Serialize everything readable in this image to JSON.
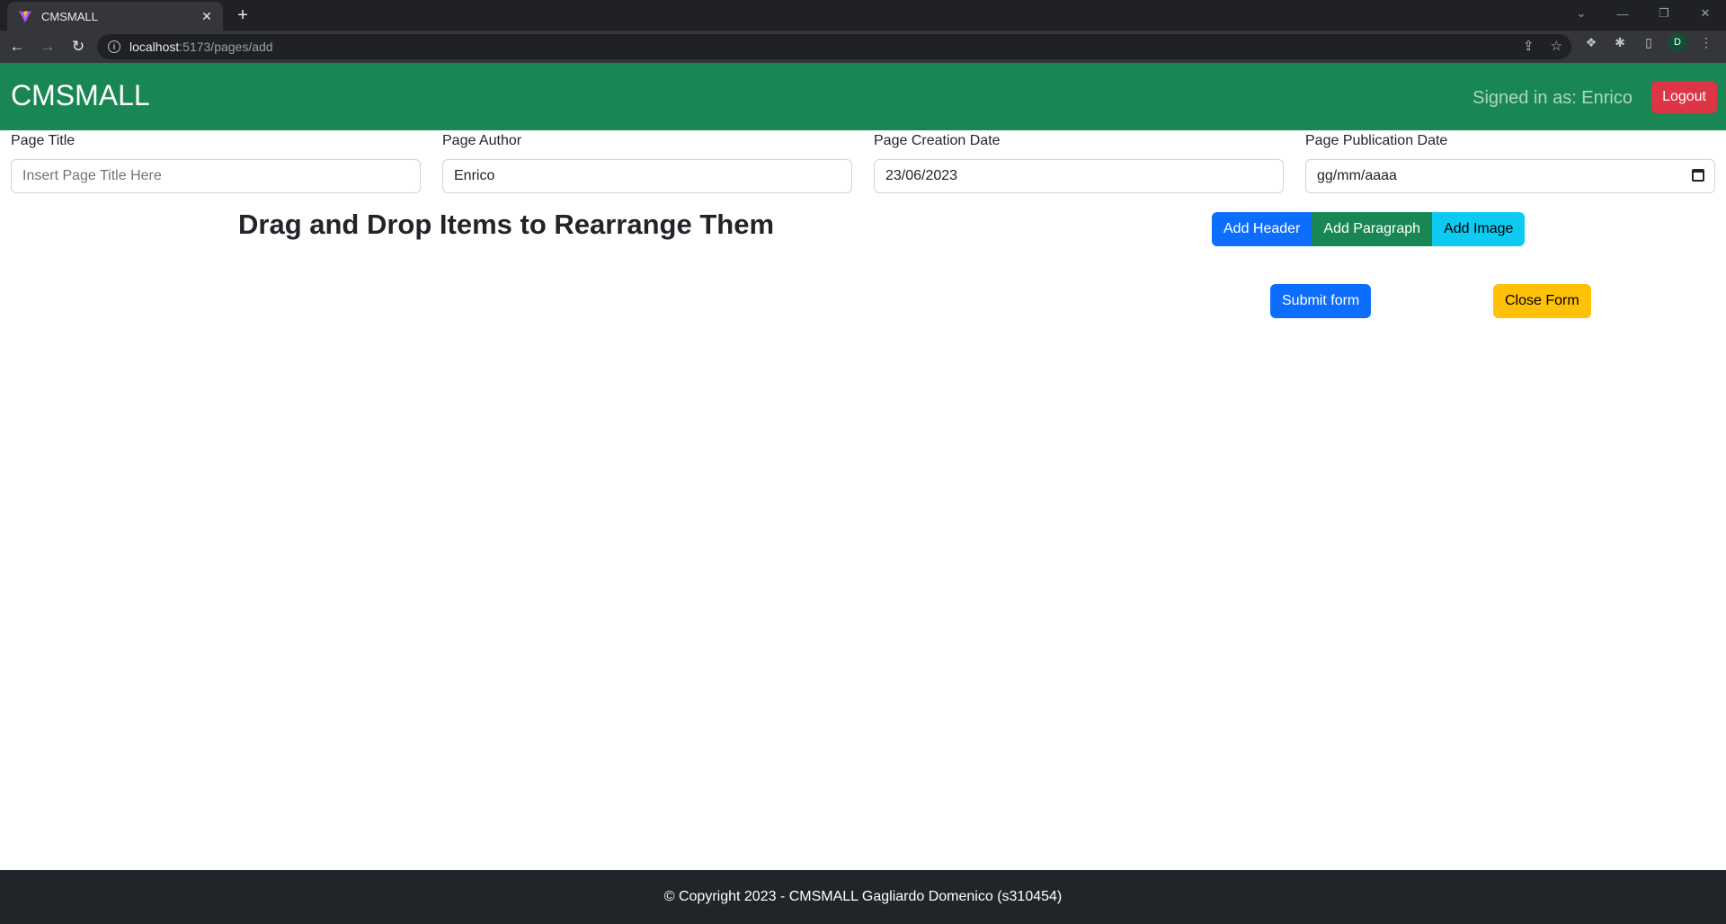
{
  "browser": {
    "tab_title": "CMSMALL",
    "url_host": "localhost",
    "url_path": ":5173/pages/add",
    "profile_initial": "D"
  },
  "navbar": {
    "brand": "CMSMALL",
    "signed_in_text": "Signed in as: Enrico",
    "logout_label": "Logout"
  },
  "form": {
    "title": {
      "label": "Page Title",
      "placeholder": "Insert Page Title Here",
      "value": ""
    },
    "author": {
      "label": "Page Author",
      "value": "Enrico"
    },
    "creation_date": {
      "label": "Page Creation Date",
      "value": "23/06/2023"
    },
    "publication_date": {
      "label": "Page Publication Date",
      "value": "gg/mm/aaaa"
    }
  },
  "content": {
    "heading": "Drag and Drop Items to Rearrange Them",
    "add_header_label": "Add Header",
    "add_paragraph_label": "Add Paragraph",
    "add_image_label": "Add Image",
    "submit_label": "Submit form",
    "close_label": "Close Form"
  },
  "footer": {
    "text": "© Copyright 2023 - CMSMALL Gagliardo Domenico (s310454)"
  },
  "colors": {
    "navbar": "#198754",
    "logout": "#dc3545",
    "primary": "#0d6efd",
    "info": "#0dcaf0",
    "warning": "#ffc107",
    "footer": "#212529"
  }
}
